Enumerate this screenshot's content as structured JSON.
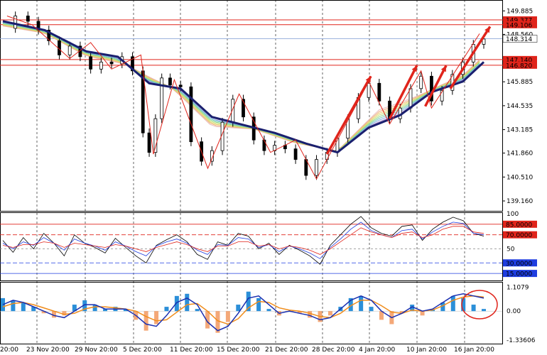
{
  "chart_data": [
    {
      "type": "candlestick",
      "panel": "price",
      "y_axis_ticks": [
        149.885,
        148.56,
        145.885,
        144.535,
        143.185,
        141.86,
        140.51,
        139.16
      ],
      "current_price": 148.314,
      "level_labels": [
        {
          "value": 149.377,
          "color": "#e0241b"
        },
        {
          "value": 149.106,
          "color": "#e0241b"
        },
        {
          "value": 147.14,
          "color": "#e0241b"
        },
        {
          "value": 146.82,
          "color": "#e0241b"
        }
      ],
      "x_axis_labels": [
        "20:00",
        "23 Nov 20:00",
        "29 Nov 20:00",
        "5 Dec 20:00",
        "11 Dec 20:00",
        "15 Dec 20:00",
        "21 Dec 20:00",
        "28 Dec 20:00",
        "4 Jan 20:00",
        "10 Jan 20:00",
        "16 Jan 20:00"
      ],
      "close_path": [
        [
          0,
          148.9
        ],
        [
          6,
          149.6
        ],
        [
          12,
          149.3
        ],
        [
          17,
          148.8
        ],
        [
          22,
          148.2
        ],
        [
          27,
          147.4
        ],
        [
          32,
          147.9
        ],
        [
          37,
          147.3
        ],
        [
          42,
          146.6
        ],
        [
          47,
          147.0
        ],
        [
          52,
          146.9
        ],
        [
          57,
          147.3
        ],
        [
          62,
          146.5
        ],
        [
          67,
          143.0
        ],
        [
          70,
          141.9
        ],
        [
          73,
          143.8
        ],
        [
          76,
          146.1
        ],
        [
          80,
          145.7
        ],
        [
          85,
          145.6
        ],
        [
          90,
          142.5
        ],
        [
          95,
          141.4
        ],
        [
          100,
          142.0
        ],
        [
          105,
          143.6
        ],
        [
          110,
          144.9
        ],
        [
          115,
          143.9
        ],
        [
          120,
          142.6
        ],
        [
          125,
          142.0
        ],
        [
          130,
          142.3
        ],
        [
          135,
          142.1
        ],
        [
          140,
          141.5
        ],
        [
          145,
          140.6
        ],
        [
          150,
          141.5
        ],
        [
          155,
          141.9
        ],
        [
          160,
          142.7
        ],
        [
          165,
          143.8
        ],
        [
          170,
          145.0
        ],
        [
          175,
          145.8
        ],
        [
          180,
          144.8
        ],
        [
          185,
          143.8
        ],
        [
          190,
          144.4
        ],
        [
          195,
          145.5
        ],
        [
          200,
          146.2
        ],
        [
          205,
          144.8
        ],
        [
          210,
          145.4
        ],
        [
          215,
          146.3
        ],
        [
          220,
          147.0
        ],
        [
          225,
          148.0
        ],
        [
          230,
          148.3
        ]
      ],
      "moving_averages": {
        "ma_fast": [
          [
            0,
            149.0
          ],
          [
            20,
            148.6
          ],
          [
            40,
            147.3
          ],
          [
            60,
            146.8
          ],
          [
            80,
            145.6
          ],
          [
            100,
            143.3
          ],
          [
            120,
            143.2
          ],
          [
            140,
            142.4
          ],
          [
            160,
            142.0
          ],
          [
            180,
            144.4
          ],
          [
            200,
            145.2
          ],
          [
            220,
            146.3
          ],
          [
            230,
            147.4
          ]
        ],
        "ma_slow": [
          [
            0,
            149.3
          ],
          [
            20,
            148.8
          ],
          [
            40,
            147.6
          ],
          [
            55,
            147.3
          ],
          [
            70,
            145.8
          ],
          [
            85,
            145.5
          ],
          [
            100,
            143.9
          ],
          [
            120,
            143.3
          ],
          [
            130,
            143.0
          ],
          [
            145,
            142.4
          ],
          [
            160,
            141.9
          ],
          [
            175,
            143.3
          ],
          [
            190,
            144.0
          ],
          [
            205,
            145.3
          ],
          [
            220,
            145.9
          ],
          [
            230,
            147.0
          ]
        ]
      },
      "annotations": [
        {
          "type": "zigzag",
          "color": "#e0241b"
        },
        {
          "type": "arrows",
          "color": "#e0241b",
          "count": 4
        }
      ]
    },
    {
      "type": "line",
      "panel": "oscillator",
      "y_axis_ticks": [
        "100",
        "85.0000",
        "70.0000",
        "50",
        "30.0000",
        "15.0000"
      ],
      "levels": [
        85,
        70,
        50,
        30,
        15
      ],
      "series": [
        {
          "color": "#000000",
          "values": [
            62,
            45,
            66,
            50,
            72,
            58,
            40,
            70,
            58,
            52,
            44,
            65,
            52,
            40,
            30,
            55,
            63,
            70,
            60,
            42,
            35,
            60,
            55,
            72,
            68,
            50,
            58,
            42,
            55,
            48,
            40,
            28,
            55,
            70,
            85,
            96,
            80,
            72,
            68,
            82,
            84,
            62,
            78,
            88,
            95,
            90,
            72,
            68
          ]
        },
        {
          "color": "#1e3de0",
          "values": [
            58,
            50,
            60,
            55,
            66,
            58,
            48,
            64,
            58,
            54,
            48,
            60,
            54,
            46,
            40,
            54,
            60,
            64,
            58,
            48,
            42,
            56,
            55,
            66,
            64,
            52,
            56,
            46,
            54,
            50,
            44,
            36,
            52,
            64,
            78,
            88,
            76,
            70,
            66,
            76,
            78,
            64,
            74,
            82,
            88,
            86,
            72,
            70
          ]
        },
        {
          "color": "#e0241b",
          "values": [
            55,
            52,
            56,
            56,
            60,
            58,
            52,
            58,
            56,
            54,
            52,
            56,
            54,
            50,
            46,
            52,
            56,
            60,
            56,
            50,
            46,
            54,
            54,
            60,
            60,
            54,
            56,
            50,
            54,
            52,
            48,
            42,
            50,
            60,
            70,
            80,
            74,
            70,
            66,
            72,
            74,
            66,
            70,
            78,
            82,
            82,
            74,
            72
          ]
        }
      ]
    },
    {
      "type": "bar",
      "panel": "macd",
      "y_axis_ticks": [
        "1.1079",
        "0.00",
        "-1.33606"
      ],
      "histogram": [
        0.6,
        0.5,
        0.4,
        0.2,
        -0.1,
        -0.3,
        -0.2,
        0.3,
        0.5,
        0.3,
        0.1,
        0.2,
        0.1,
        -0.4,
        -0.9,
        -0.6,
        0.2,
        0.7,
        0.8,
        0.1,
        -0.8,
        -1.0,
        -0.5,
        0.3,
        0.9,
        0.6,
        0.1,
        -0.2,
        0.0,
        -0.1,
        -0.3,
        -0.5,
        -0.2,
        0.2,
        0.6,
        0.7,
        0.2,
        -0.4,
        -0.6,
        -0.1,
        0.3,
        -0.2,
        0.1,
        0.4,
        0.7,
        0.6,
        0.3,
        0.1
      ],
      "macd_line": [
        0.3,
        0.5,
        0.4,
        0.2,
        0.0,
        -0.2,
        -0.3,
        0.0,
        0.3,
        0.3,
        0.1,
        0.1,
        0.1,
        -0.2,
        -0.6,
        -0.7,
        -0.2,
        0.4,
        0.6,
        0.3,
        -0.5,
        -0.9,
        -0.7,
        -0.1,
        0.6,
        0.7,
        0.3,
        -0.1,
        0.0,
        -0.1,
        -0.2,
        -0.4,
        -0.3,
        0.1,
        0.5,
        0.7,
        0.5,
        0.0,
        -0.3,
        -0.1,
        0.2,
        0.0,
        0.1,
        0.4,
        0.7,
        0.8,
        0.7,
        0.6
      ],
      "signal_line": [
        0.2,
        0.35,
        0.4,
        0.3,
        0.15,
        0.0,
        -0.15,
        -0.1,
        0.1,
        0.2,
        0.2,
        0.15,
        0.1,
        0.0,
        -0.25,
        -0.45,
        -0.4,
        -0.05,
        0.3,
        0.35,
        0.0,
        -0.45,
        -0.6,
        -0.35,
        0.15,
        0.45,
        0.4,
        0.15,
        0.05,
        0.0,
        -0.1,
        -0.25,
        -0.3,
        -0.1,
        0.25,
        0.5,
        0.5,
        0.25,
        -0.05,
        -0.1,
        0.05,
        0.0,
        0.05,
        0.25,
        0.5,
        0.65,
        0.7,
        0.65
      ],
      "circle_annotation_color": "#e0241b"
    }
  ]
}
